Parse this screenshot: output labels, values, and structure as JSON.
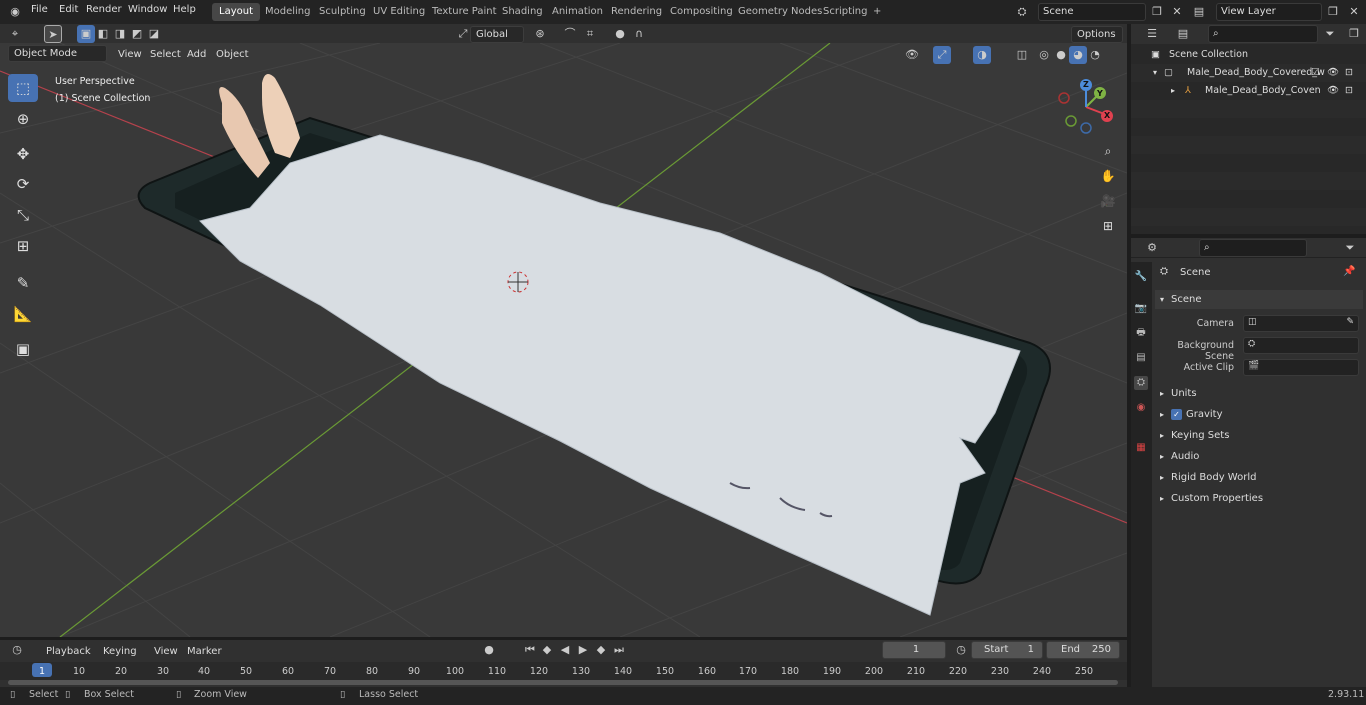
{
  "menu": {
    "items": [
      "File",
      "Edit",
      "Render",
      "Window",
      "Help"
    ]
  },
  "workspaces": [
    "Layout",
    "Modeling",
    "Sculpting",
    "UV Editing",
    "Texture Paint",
    "Shading",
    "Animation",
    "Rendering",
    "Compositing",
    "Geometry Nodes",
    "Scripting"
  ],
  "add_tab": "+",
  "scene_field": "Scene",
  "view_layer_field": "View Layer",
  "viewport_header": {
    "mode": "Object Mode",
    "view": "View",
    "select": "Select",
    "add": "Add",
    "object": "Object",
    "transform": "Global",
    "options": "Options"
  },
  "overlay_text": {
    "perspective": "User Perspective",
    "collection": "(1) Scene Collection"
  },
  "gizmo": {
    "x": "X",
    "y": "Y",
    "z": "Z"
  },
  "outliner": {
    "root": "Scene Collection",
    "collection": "Male_Dead_Body_Covered_w",
    "object": "Male_Dead_Body_Coven"
  },
  "properties": {
    "context": "Scene",
    "panel_scene": "Scene",
    "camera_label": "Camera",
    "background_label": "Background Scene",
    "clip_label": "Active Clip",
    "panels": [
      "Units",
      "Gravity",
      "Keying Sets",
      "Audio",
      "Rigid Body World",
      "Custom Properties"
    ],
    "gravity_checked": true
  },
  "timeline": {
    "playback": "Playback",
    "keying": "Keying",
    "view": "View",
    "marker": "Marker",
    "current_frame": "1",
    "start_label": "Start",
    "start_value": "1",
    "end_label": "End",
    "end_value": "250",
    "ruler": [
      "1",
      "10",
      "20",
      "30",
      "40",
      "50",
      "60",
      "70",
      "80",
      "90",
      "100",
      "110",
      "120",
      "130",
      "140",
      "150",
      "160",
      "170",
      "180",
      "190",
      "200",
      "210",
      "220",
      "230",
      "240",
      "250"
    ]
  },
  "statusbar": {
    "select": "Select",
    "box_select": "Box Select",
    "zoom_view": "Zoom View",
    "lasso_select": "Lasso Select",
    "version": "2.93.11"
  },
  "colors": {
    "accent": "#4772b3",
    "x_axis": "#e0414f",
    "y_axis": "#7fb344",
    "z_axis": "#4c8cdb"
  }
}
